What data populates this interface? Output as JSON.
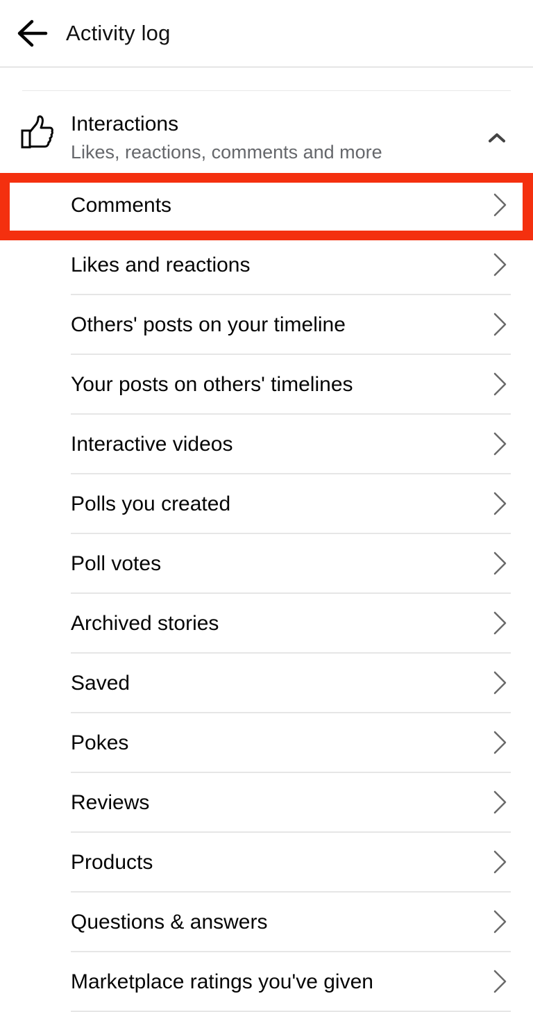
{
  "header": {
    "title": "Activity log",
    "back_icon": "arrow-left-icon"
  },
  "section": {
    "icon": "thumbs-up-icon",
    "title": "Interactions",
    "subtitle": "Likes, reactions, comments and more",
    "toggle_icon": "chevron-up-icon",
    "expanded": true
  },
  "items": [
    {
      "label": "Comments",
      "highlighted": true
    },
    {
      "label": "Likes and reactions"
    },
    {
      "label": "Others' posts on your timeline"
    },
    {
      "label": "Your posts on others' timelines"
    },
    {
      "label": "Interactive videos"
    },
    {
      "label": "Polls you created"
    },
    {
      "label": "Poll votes"
    },
    {
      "label": "Archived stories"
    },
    {
      "label": "Saved"
    },
    {
      "label": "Pokes"
    },
    {
      "label": "Reviews"
    },
    {
      "label": "Products"
    },
    {
      "label": "Questions & answers"
    },
    {
      "label": "Marketplace ratings you've given"
    }
  ],
  "item_icon": "chevron-right-icon",
  "colors": {
    "highlight": "#f4300f",
    "text_primary": "#050505",
    "text_secondary": "#65676b",
    "divider": "#e6e6e6"
  }
}
